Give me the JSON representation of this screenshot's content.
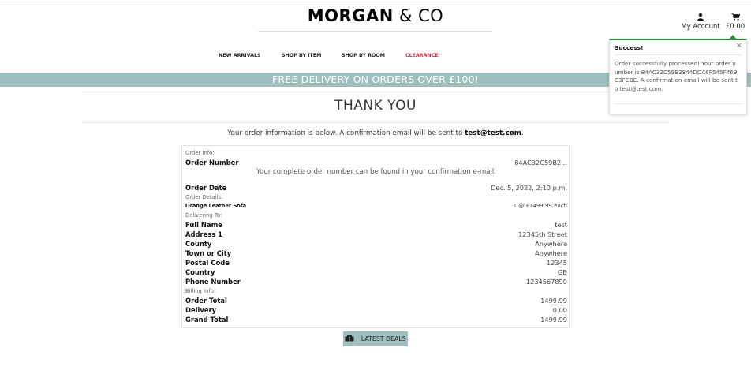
{
  "brand": {
    "name_bold": "MORGAN",
    "name_light": "& CO"
  },
  "header": {
    "account_label": "My Account",
    "basket_total": "£0.00"
  },
  "nav": {
    "items": [
      "NEW ARRIVALS",
      "SHOP BY ITEM",
      "SHOP BY ROOM",
      "CLEARANCE"
    ]
  },
  "banner": {
    "text": "FREE DELIVERY ON ORDERS OVER £100!"
  },
  "page": {
    "title": "THANK YOU",
    "info_prefix": "Your order information is below. A confirmation email will be sent to ",
    "info_email": "test@test.com",
    "info_suffix": "."
  },
  "order": {
    "order_info_label": "Order Info:",
    "order_number_label": "Order Number",
    "order_number_value": "84AC32C59B2...",
    "order_number_note": "Your complete order number can be found in your confirmation e-mail.",
    "order_date_label": "Order Date",
    "order_date_value": "Dec. 5, 2022, 2:10 p.m.",
    "order_details_label": "Order Details:",
    "item_name": "Orange Leather Sofa",
    "item_qty_price": "1 @ £1499.99 each",
    "delivering_label": "Delivering To:",
    "delivery": [
      {
        "label": "Full Name",
        "value": "test"
      },
      {
        "label": "Address 1",
        "value": "12345th Street"
      },
      {
        "label": "County",
        "value": "Anywhere"
      },
      {
        "label": "Town or City",
        "value": "Anywhere"
      },
      {
        "label": "Postal Code",
        "value": "12345"
      },
      {
        "label": "Country",
        "value": "GB"
      },
      {
        "label": "Phone Number",
        "value": "1234567890"
      }
    ],
    "billing_label": "Billing Info:",
    "billing": [
      {
        "label": "Order Total",
        "value": "1499.99"
      },
      {
        "label": "Delivery",
        "value": "0.00"
      },
      {
        "label": "Grand Total",
        "value": "1499.99"
      }
    ]
  },
  "deals_button": {
    "label": "LATEST DEALS"
  },
  "toast": {
    "title": "Success!",
    "message": "Order successfully processed! Your order number is 84AC32C59B2844DDA6F545F469C3FCBE. A confirmation email will be sent to test@test.com.",
    "accent": "#2e8b3a"
  },
  "colors": {
    "banner": "#9fbfbf",
    "clearance": "#d8303c"
  }
}
